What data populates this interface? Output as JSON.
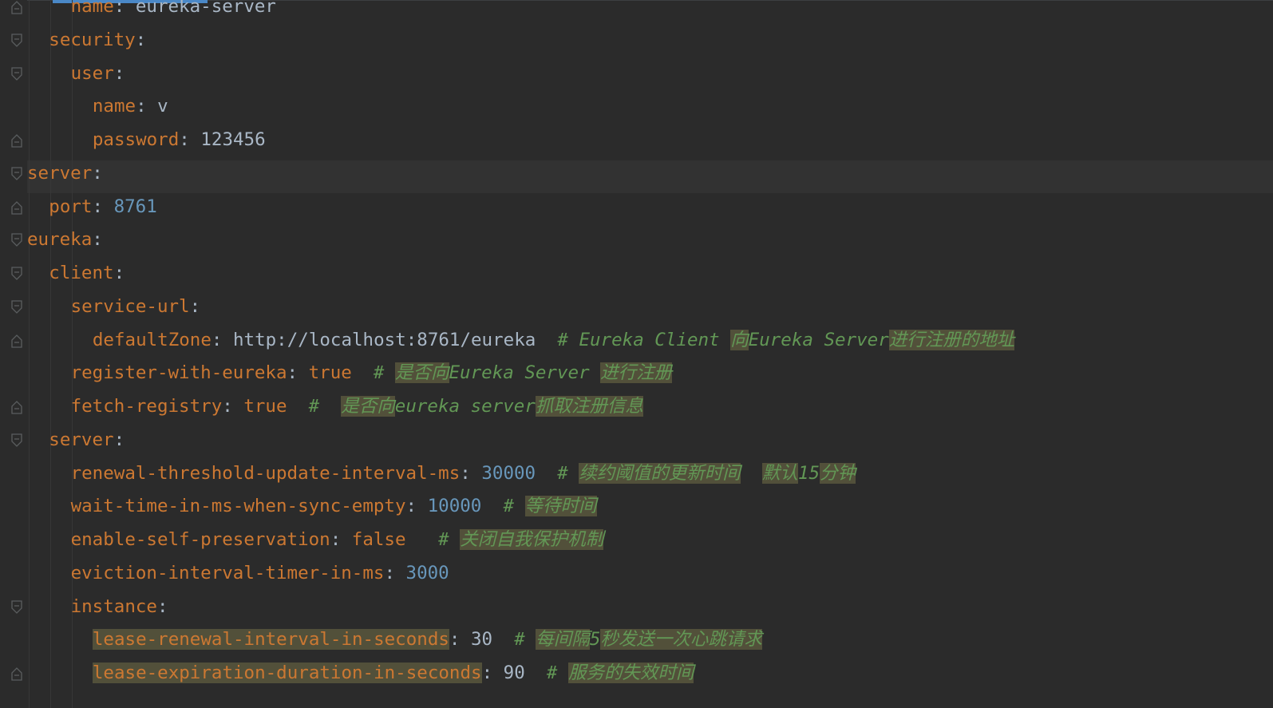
{
  "lines": [
    {
      "indent": 2,
      "fold": "end",
      "key": "name",
      "value": "eureka-server",
      "value_type": "str"
    },
    {
      "indent": 1,
      "fold": "start",
      "key": "security",
      "value": "",
      "value_type": ""
    },
    {
      "indent": 2,
      "fold": "start",
      "key": "user",
      "value": "",
      "value_type": ""
    },
    {
      "indent": 3,
      "fold": "",
      "key": "name",
      "value": "v",
      "value_type": "str"
    },
    {
      "indent": 3,
      "fold": "end",
      "key": "password",
      "value": "123456",
      "value_type": "str"
    },
    {
      "indent": 0,
      "fold": "start",
      "key": "server",
      "value": "",
      "value_type": ""
    },
    {
      "indent": 1,
      "fold": "end",
      "key": "port",
      "value": "8761",
      "value_type": "num"
    },
    {
      "indent": 0,
      "fold": "start",
      "key": "eureka",
      "value": "",
      "value_type": ""
    },
    {
      "indent": 1,
      "fold": "start",
      "key": "client",
      "value": "",
      "value_type": ""
    },
    {
      "indent": 2,
      "fold": "start",
      "key": "service-url",
      "value": "",
      "value_type": ""
    },
    {
      "indent": 3,
      "fold": "end",
      "key": "defaultZone",
      "value": "http://localhost:8761/eureka",
      "value_type": "str",
      "comment": [
        {
          "t": "# Eureka Client "
        },
        {
          "t": "向",
          "hl": true
        },
        {
          "t": "Eureka Server"
        },
        {
          "t": "进行注册的地址",
          "hl": true
        }
      ]
    },
    {
      "indent": 2,
      "fold": "",
      "key": "register-with-eureka",
      "value": "true",
      "value_type": "kw",
      "comment": [
        {
          "t": "# "
        },
        {
          "t": "是否向",
          "hl": true
        },
        {
          "t": "Eureka Server "
        },
        {
          "t": "进行注册",
          "hl": true
        }
      ]
    },
    {
      "indent": 2,
      "fold": "end",
      "key": "fetch-registry",
      "value": "true",
      "value_type": "kw",
      "comment": [
        {
          "t": "#  "
        },
        {
          "t": "是否向",
          "hl": true
        },
        {
          "t": "eureka server"
        },
        {
          "t": "抓取注册信息",
          "hl": true
        }
      ]
    },
    {
      "indent": 1,
      "fold": "start",
      "key": "server",
      "value": "",
      "value_type": ""
    },
    {
      "indent": 2,
      "fold": "",
      "key": "renewal-threshold-update-interval-ms",
      "value": "30000",
      "value_type": "num",
      "comment": [
        {
          "t": "# "
        },
        {
          "t": "续约阈值的更新时间",
          "hl": true
        },
        {
          "t": "  "
        },
        {
          "t": "默认",
          "hl": true
        },
        {
          "t": "15"
        },
        {
          "t": "分钟",
          "hl": true
        }
      ]
    },
    {
      "indent": 2,
      "fold": "",
      "key": "wait-time-in-ms-when-sync-empty",
      "value": "10000",
      "value_type": "num",
      "comment": [
        {
          "t": "# "
        },
        {
          "t": "等待时间",
          "hl": true
        }
      ]
    },
    {
      "indent": 2,
      "fold": "",
      "key": "enable-self-preservation",
      "value": "false",
      "value_type": "kw",
      "gap": "   ",
      "comment": [
        {
          "t": "# "
        },
        {
          "t": "关闭自我保护机制",
          "hl": true
        }
      ]
    },
    {
      "indent": 2,
      "fold": "",
      "key": "eviction-interval-timer-in-ms",
      "value": "3000",
      "value_type": "num"
    },
    {
      "indent": 2,
      "fold": "start",
      "key": "instance",
      "value": "",
      "value_type": ""
    },
    {
      "indent": 3,
      "fold": "",
      "key": "lease-renewal-interval-in-seconds",
      "key_hl": true,
      "value": "30",
      "value_type": "str",
      "comment": [
        {
          "t": "# "
        },
        {
          "t": "每间隔",
          "hl": true
        },
        {
          "t": "5"
        },
        {
          "t": "秒发送一次心跳请求",
          "hl": true
        }
      ]
    },
    {
      "indent": 3,
      "fold": "end",
      "key": "lease-expiration-duration-in-seconds",
      "key_hl": true,
      "value": "90",
      "value_type": "str",
      "comment": [
        {
          "t": "# "
        },
        {
          "t": "服务的失效时间",
          "hl": true
        }
      ]
    }
  ],
  "colors": {
    "background": "#2b2b2b",
    "key": "#cc7832",
    "number": "#6897bb",
    "comment": "#629755",
    "text": "#a9b7c6",
    "highlight": "#52503a"
  }
}
